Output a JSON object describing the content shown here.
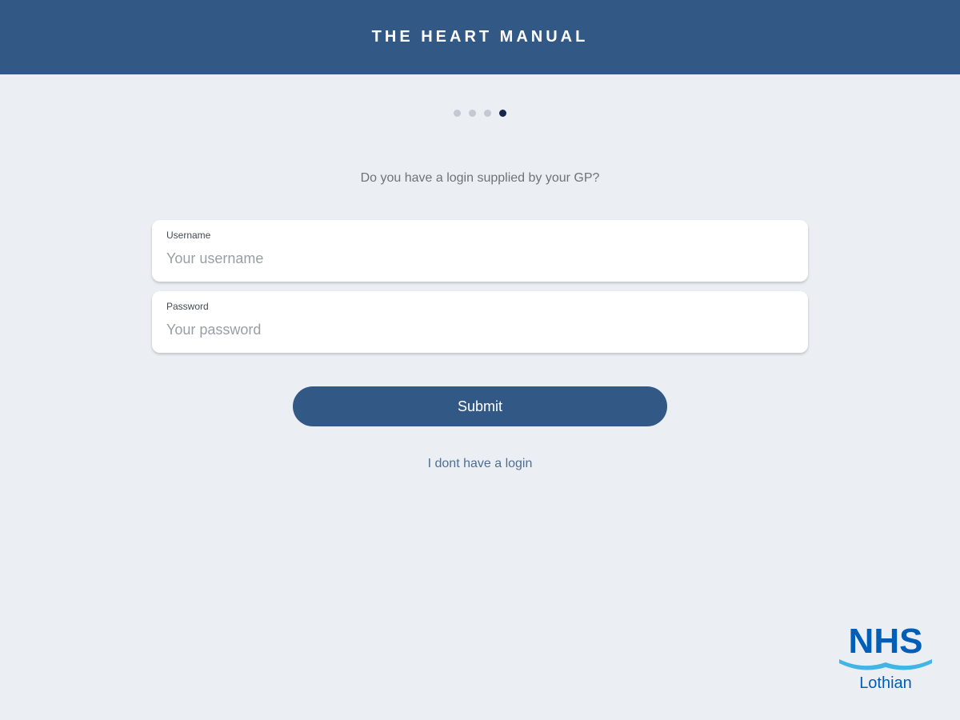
{
  "header": {
    "title": "THE HEART MANUAL"
  },
  "pager": {
    "total_steps": 4,
    "current_step": 4
  },
  "prompt": "Do you have a login supplied by your GP?",
  "form": {
    "username": {
      "label": "Username",
      "placeholder": "Your username",
      "value": ""
    },
    "password": {
      "label": "Password",
      "placeholder": "Your password",
      "value": ""
    },
    "submit_label": "Submit"
  },
  "no_login_link": "I dont have a login",
  "logo": {
    "line1": "NHS",
    "line2": "Lothian"
  },
  "colors": {
    "brand": "#325985",
    "background": "#ebeff3",
    "logo_blue": "#005eb8",
    "logo_wave": "#41b6e6",
    "active_dot": "#17264d"
  }
}
